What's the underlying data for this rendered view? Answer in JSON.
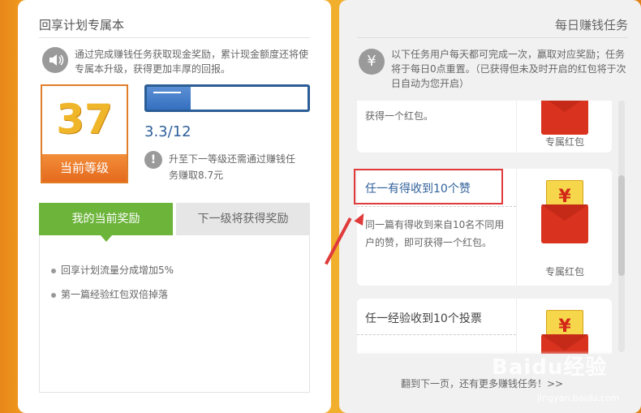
{
  "left": {
    "title": "回享计划专属本",
    "intro": "通过完成赚钱任务获取现金奖励，累计现金额度还将使专属本升级，获得更加丰厚的回报。",
    "intro_icon": "speaker-icon",
    "level": {
      "number": "37",
      "label": "当前等级"
    },
    "progress": {
      "text": "3.3/12",
      "fraction": 0.275
    },
    "tip": {
      "icon": "!",
      "text": "升至下一等级还需通过赚钱任务赚取8.7元"
    },
    "tabs": {
      "active": "我的当前奖励",
      "inactive": "下一级将获得奖励"
    },
    "rewards": [
      "回享计划流量分成增加5%",
      "第一篇经验红包双倍掉落"
    ]
  },
  "right": {
    "title": "每日赚钱任务",
    "intro": "以下任务用户每天都可完成一次，赢取对应奖励；任务将于每日0点重置。（已获得但未及时开启的红包将于次日自动为您开启）",
    "intro_icon": "¥",
    "tasks": [
      {
        "title": "",
        "desc_tail": "获得一个红包。",
        "envelope_label": "专属红包"
      },
      {
        "title": "任一有得收到10个赞",
        "desc": "同一篇有得收到来自10名不同用户的赞，即可获得一个红包。",
        "envelope_label": "专属红包",
        "coin": "¥"
      },
      {
        "title": "任一经验收到10个投票",
        "coin": "¥"
      }
    ],
    "next_page": "翻到下一页，还有更多赚钱任务！>>"
  },
  "watermark": {
    "main": "Baidu经验",
    "sub": "jingyan.baidu.com"
  },
  "colors": {
    "accent_orange": "#e07e28",
    "tab_green": "#6cb43a",
    "progress_blue": "#2b5d96",
    "annotation_red": "#e03a3a"
  }
}
